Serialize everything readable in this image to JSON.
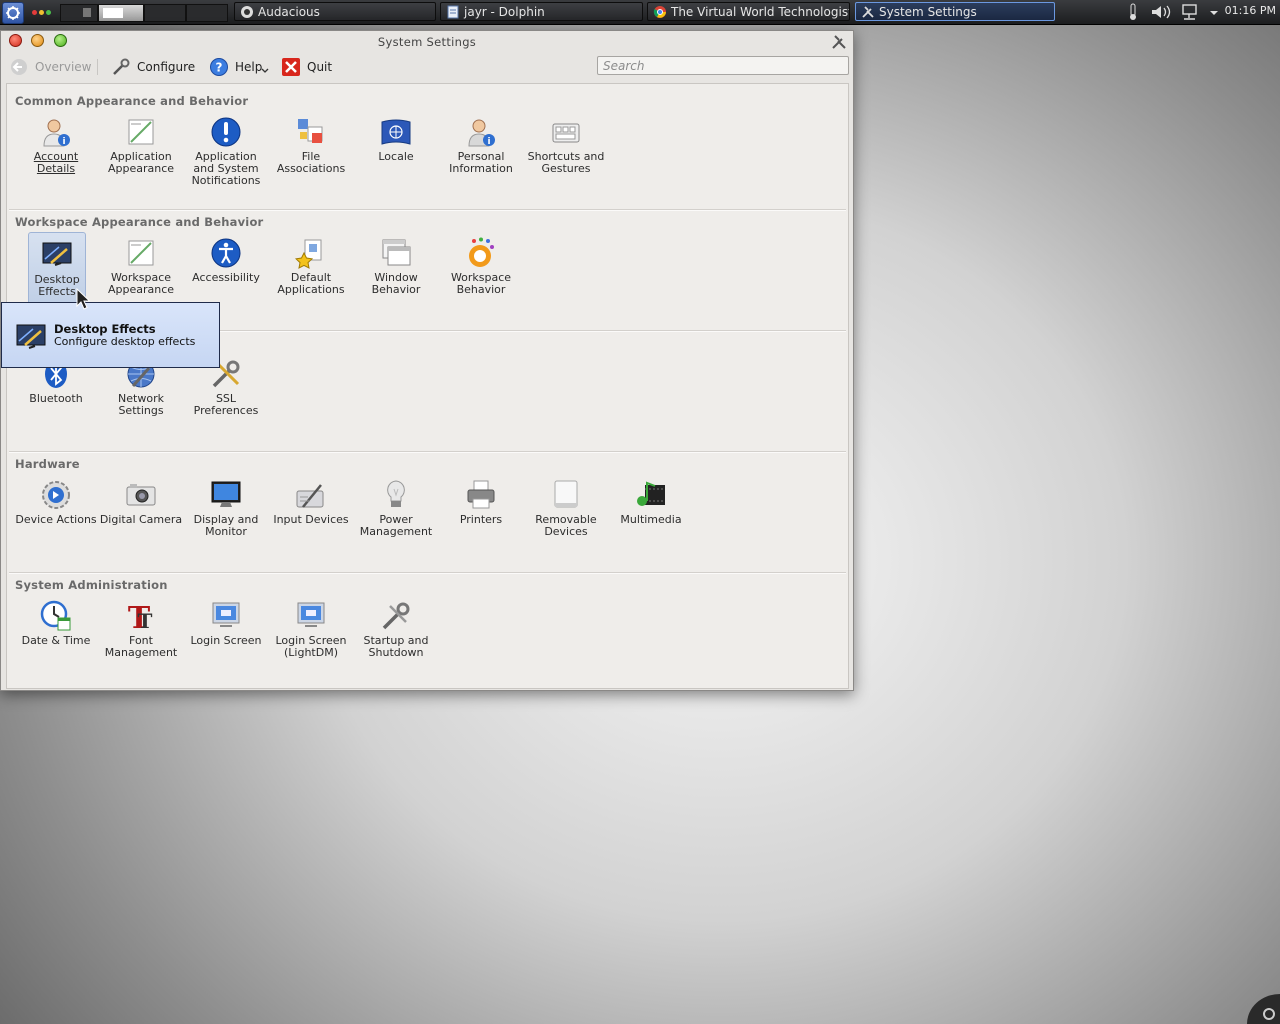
{
  "taskbar": {
    "tasks": [
      {
        "label": "Audacious",
        "icon": "audacious-icon"
      },
      {
        "label": "jayr - Dolphin",
        "icon": "dolphin-icon"
      },
      {
        "label": "The Virtual World Technologist",
        "icon": "chrome-icon"
      },
      {
        "label": "System Settings",
        "icon": "system-settings-icon"
      }
    ],
    "clock": "01:16 PM"
  },
  "window": {
    "title": "System Settings",
    "toolbar": {
      "overview": "Overview",
      "configure": "Configure",
      "help": "Help",
      "quit": "Quit"
    },
    "search": {
      "placeholder": "Search",
      "value": ""
    }
  },
  "sections": [
    {
      "title": "Common Appearance and Behavior",
      "items": [
        {
          "label": "Account Details",
          "icon": "account-details-icon"
        },
        {
          "label": "Application Appearance",
          "icon": "application-appearance-icon"
        },
        {
          "label": "Application and System Notifications",
          "icon": "notifications-icon"
        },
        {
          "label": "File Associations",
          "icon": "file-associations-icon"
        },
        {
          "label": "Locale",
          "icon": "locale-icon"
        },
        {
          "label": "Personal Information",
          "icon": "personal-information-icon"
        },
        {
          "label": "Shortcuts and Gestures",
          "icon": "shortcuts-icon"
        }
      ]
    },
    {
      "title": "Workspace Appearance and Behavior",
      "items": [
        {
          "label": "Desktop Effects",
          "icon": "desktop-effects-icon"
        },
        {
          "label": "Workspace Appearance",
          "icon": "workspace-appearance-icon"
        },
        {
          "label": "Accessibility",
          "icon": "accessibility-icon"
        },
        {
          "label": "Default Applications",
          "icon": "default-applications-icon"
        },
        {
          "label": "Window Behavior",
          "icon": "window-behavior-icon"
        },
        {
          "label": "Workspace Behavior",
          "icon": "workspace-behavior-icon"
        }
      ]
    },
    {
      "title": "",
      "items": [
        {
          "label": "Bluetooth",
          "icon": "bluetooth-icon"
        },
        {
          "label": "Network Settings",
          "icon": "network-settings-icon"
        },
        {
          "label": "SSL Preferences",
          "icon": "ssl-preferences-icon"
        }
      ]
    },
    {
      "title": "Hardware",
      "items": [
        {
          "label": "Device Actions",
          "icon": "device-actions-icon"
        },
        {
          "label": "Digital Camera",
          "icon": "digital-camera-icon"
        },
        {
          "label": "Display and Monitor",
          "icon": "display-monitor-icon"
        },
        {
          "label": "Input Devices",
          "icon": "input-devices-icon"
        },
        {
          "label": "Power Management",
          "icon": "power-management-icon"
        },
        {
          "label": "Printers",
          "icon": "printers-icon"
        },
        {
          "label": "Removable Devices",
          "icon": "removable-devices-icon"
        },
        {
          "label": "Multimedia",
          "icon": "multimedia-icon"
        }
      ]
    },
    {
      "title": "System Administration",
      "items": [
        {
          "label": "Date & Time",
          "icon": "date-time-icon"
        },
        {
          "label": "Font Management",
          "icon": "font-management-icon"
        },
        {
          "label": "Login Screen",
          "icon": "login-screen-icon"
        },
        {
          "label": "Login Screen (LightDM)",
          "icon": "login-screen-lightdm-icon"
        },
        {
          "label": "Startup and Shutdown",
          "icon": "startup-shutdown-icon"
        }
      ]
    }
  ],
  "tooltip": {
    "title": "Desktop Effects",
    "description": "Configure desktop effects"
  },
  "colors": {
    "accent": "#4a7fd0",
    "tooltip_bg": "#cddbf6",
    "window_bg": "#e7e5e2"
  }
}
